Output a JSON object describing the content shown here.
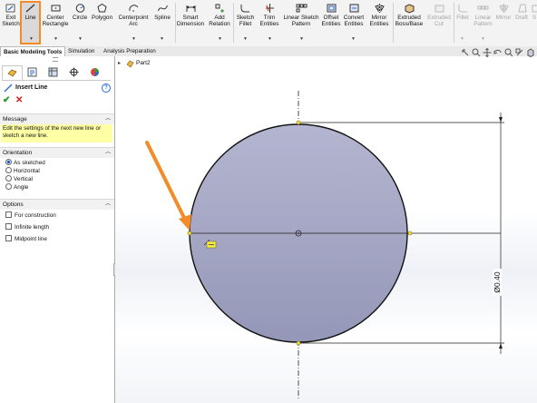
{
  "ribbon": {
    "tools": [
      {
        "label1": "Exit",
        "label2": "Sketch"
      },
      {
        "label1": "Line",
        "label2": ""
      },
      {
        "label1": "Center",
        "label2": "Rectangle"
      },
      {
        "label1": "Circle",
        "label2": ""
      },
      {
        "label1": "Polygon",
        "label2": ""
      },
      {
        "label1": "Centerpoint",
        "label2": "Arc"
      },
      {
        "label1": "Spline",
        "label2": ""
      },
      {
        "label1": "Smart",
        "label2": "Dimension"
      },
      {
        "label1": "Add",
        "label2": "Relation"
      },
      {
        "label1": "Sketch",
        "label2": "Fillet"
      },
      {
        "label1": "Trim",
        "label2": "Entities"
      },
      {
        "label1": "Linear Sketch",
        "label2": "Pattern"
      },
      {
        "label1": "Offset",
        "label2": "Entities"
      },
      {
        "label1": "Convert",
        "label2": "Entities"
      },
      {
        "label1": "Mirror",
        "label2": "Entities"
      },
      {
        "label1": "Extruded",
        "label2": "Boss/Base"
      },
      {
        "label1": "Extruded",
        "label2": "Cut"
      },
      {
        "label1": "Fillet",
        "label2": ""
      },
      {
        "label1": "Linear",
        "label2": "Pattern"
      },
      {
        "label1": "Mirror",
        "label2": ""
      },
      {
        "label1": "Draft",
        "label2": ""
      },
      {
        "label1": "S",
        "label2": ""
      }
    ],
    "highlight_color": "#f28c28"
  },
  "tabs": [
    "Basic Modeling Tools",
    "Simulation",
    "Analysis Preparation"
  ],
  "panel": {
    "command_title": "Insert Line",
    "message_header": "Message",
    "message_text": "Edit the settings of the next new line or sketch a new line.",
    "orientation_header": "Orientation",
    "orientation_options": [
      "As sketched",
      "Horizontal",
      "Vertical",
      "Angle"
    ],
    "orientation_selected": "As sketched",
    "options_header": "Options",
    "options": [
      "For construction",
      "Infinite length",
      "Midpoint line"
    ]
  },
  "canvas": {
    "tree_item": "Part2",
    "dimension_text": "Ø0.40",
    "circle_fill": "#a3a5c4",
    "annotation_arrow_color": "#f28c28"
  }
}
